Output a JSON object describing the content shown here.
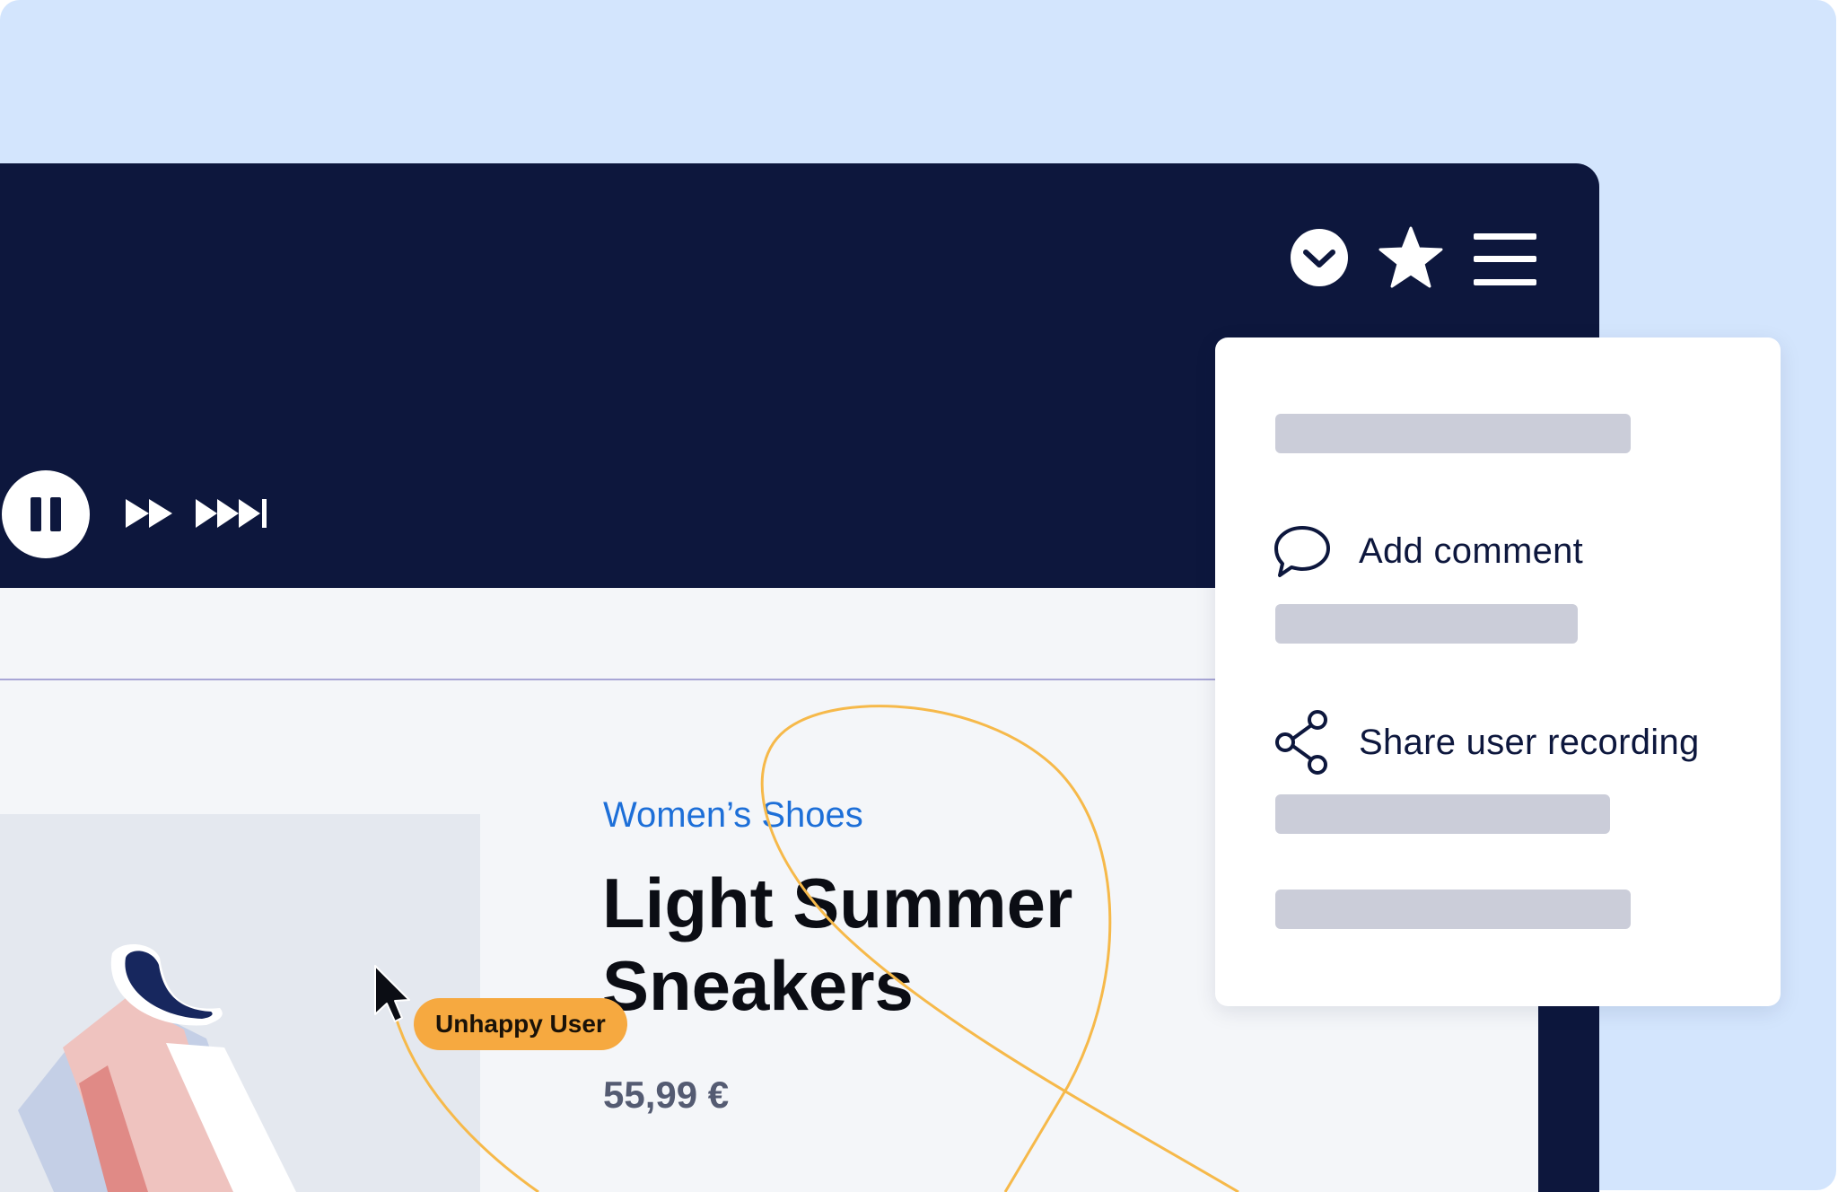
{
  "player": {
    "controls": {
      "pause_icon": "pause-icon",
      "fast_forward_icon": "fast-forward-icon",
      "skip_to_end_icon": "skip-forward-icon"
    },
    "toolbar": {
      "icons": [
        "chevron-down-circle-icon",
        "star-icon",
        "hamburger-menu-icon"
      ]
    },
    "timeline_segment_colors": [
      "#39406f",
      "#8a8fa8",
      "#939dcb",
      "#6a66ad",
      "#4a4d86"
    ]
  },
  "menu": {
    "items": [
      {
        "label": "Add comment",
        "icon": "comment-icon"
      },
      {
        "label": "Share user recording",
        "icon": "share-icon"
      }
    ]
  },
  "product": {
    "category": "Women’s Shoes",
    "title": "Light Summer Sneakers",
    "price": "55,99 €"
  },
  "annotation": {
    "badge": "Unhappy User",
    "color": "#f6a940"
  },
  "colors": {
    "background": "#d3e5fd",
    "player": "#0d173d",
    "link": "#1d6fd8",
    "skeleton": "#cbcdd9"
  }
}
